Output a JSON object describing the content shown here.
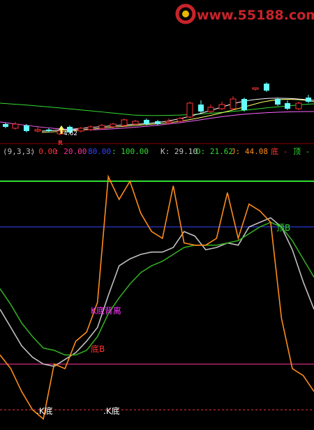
{
  "watermark": {
    "text": "www.55188.com",
    "color": "#c8232a"
  },
  "params": {
    "label": "(9,3,3)",
    "levels": [
      {
        "text": ": 0.00",
        "color": "#ff3333"
      },
      {
        "text": ": 20.00",
        "color": "#ff3399"
      },
      {
        "text": "80.00",
        "color": "#3344ff"
      },
      {
        "text": ": 100.00",
        "color": "#33dd33"
      }
    ],
    "k": "K: 29.10",
    "d": "D: 21.62",
    "j": "J: 44.08",
    "bottom_label": "底 -",
    "top_label": "顶 -"
  },
  "markers": {
    "price_label": "4.62",
    "r_label": "R"
  },
  "annotations": {
    "k_divergence": "K底背离",
    "bottom_b": "底B",
    "top_b": "顶B",
    "k_bottom_1": ".K底",
    "k_bottom_2": ".K底"
  },
  "colors": {
    "bg": "#000000",
    "k_line": "#c0c0c0",
    "d_line": "#33aa22",
    "j_line": "#ff8c1a",
    "line100": "#33dd33",
    "line80": "#3344ff",
    "line20": "#ff3399",
    "line0": "#ff3333",
    "candle_up": "#ff3333",
    "candle_down": "#66ffff",
    "ma1": "#ffffff",
    "ma2": "#ffff66",
    "ma3": "#ff66ff",
    "ma4": "#33dd33"
  },
  "chart_data": {
    "type": "line",
    "ylim": [
      0,
      100
    ],
    "reference_lines": [
      100,
      80,
      20,
      0
    ],
    "x": [
      0,
      1,
      2,
      3,
      4,
      5,
      6,
      7,
      8,
      9,
      10,
      11,
      12,
      13,
      14,
      15,
      16,
      17,
      18,
      19,
      20,
      21,
      22,
      23,
      24,
      25,
      26,
      27,
      28,
      29
    ],
    "series": [
      {
        "name": "K",
        "values": [
          44,
          36,
          28,
          23,
          20,
          19,
          22,
          25,
          30,
          36,
          50,
          63,
          66,
          68,
          69,
          69,
          71,
          78,
          76,
          70,
          71,
          73,
          72,
          80,
          82,
          84,
          80,
          70,
          56,
          44
        ]
      },
      {
        "name": "D",
        "values": [
          53,
          46,
          38,
          32,
          27,
          26,
          24,
          24,
          26,
          32,
          42,
          49,
          55,
          60,
          63,
          65,
          68,
          71,
          72,
          72,
          72,
          73,
          74,
          77,
          80,
          82,
          80,
          74,
          66,
          58
        ]
      },
      {
        "name": "J",
        "values": [
          24,
          18,
          8,
          0,
          -4,
          20,
          18,
          30,
          34,
          47,
          102,
          92,
          100,
          86,
          78,
          75,
          98,
          73,
          72,
          72,
          75,
          95,
          75,
          90,
          87,
          82,
          40,
          18,
          15,
          8
        ]
      }
    ]
  }
}
